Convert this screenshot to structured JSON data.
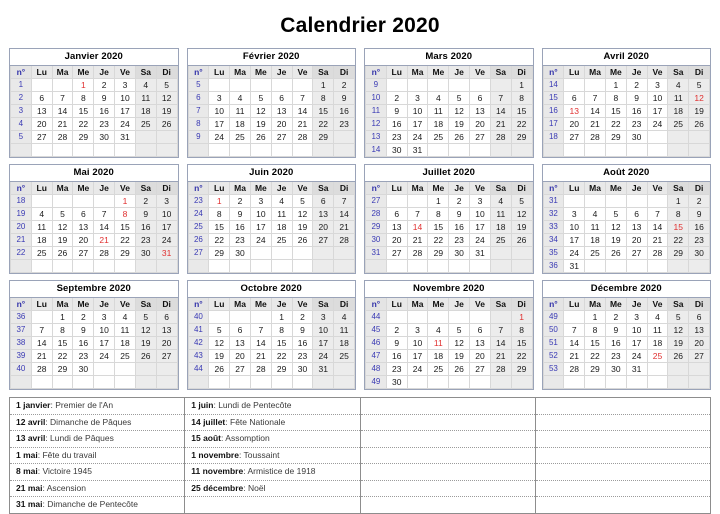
{
  "title": "Calendrier 2020",
  "colors": {
    "holiday": "#e03030",
    "weeknum": "#3a3ab4",
    "weekend_bg": "#ececec",
    "header_bg": "#e9e9e9",
    "month_border": "#9aa3b8"
  },
  "dow_header": {
    "weeknum": "n°",
    "days": [
      "Lu",
      "Ma",
      "Me",
      "Je",
      "Ve",
      "Sa",
      "Di"
    ]
  },
  "months": [
    {
      "name": "Janvier 2020",
      "weeks": [
        {
          "n": "1",
          "days": [
            "",
            "",
            "1",
            "2",
            "3",
            "4",
            "5"
          ],
          "holidays": [
            1
          ]
        },
        {
          "n": "2",
          "days": [
            "6",
            "7",
            "8",
            "9",
            "10",
            "11",
            "12"
          ],
          "holidays": []
        },
        {
          "n": "3",
          "days": [
            "13",
            "14",
            "15",
            "16",
            "17",
            "18",
            "19"
          ],
          "holidays": []
        },
        {
          "n": "4",
          "days": [
            "20",
            "21",
            "22",
            "23",
            "24",
            "25",
            "26"
          ],
          "holidays": []
        },
        {
          "n": "5",
          "days": [
            "27",
            "28",
            "29",
            "30",
            "31",
            "",
            ""
          ],
          "holidays": []
        }
      ]
    },
    {
      "name": "Février 2020",
      "weeks": [
        {
          "n": "5",
          "days": [
            "",
            "",
            "",
            "",
            "",
            "1",
            "2"
          ],
          "holidays": []
        },
        {
          "n": "6",
          "days": [
            "3",
            "4",
            "5",
            "6",
            "7",
            "8",
            "9"
          ],
          "holidays": []
        },
        {
          "n": "7",
          "days": [
            "10",
            "11",
            "12",
            "13",
            "14",
            "15",
            "16"
          ],
          "holidays": []
        },
        {
          "n": "8",
          "days": [
            "17",
            "18",
            "19",
            "20",
            "21",
            "22",
            "23"
          ],
          "holidays": []
        },
        {
          "n": "9",
          "days": [
            "24",
            "25",
            "26",
            "27",
            "28",
            "29",
            ""
          ],
          "holidays": []
        }
      ]
    },
    {
      "name": "Mars 2020",
      "weeks": [
        {
          "n": "9",
          "days": [
            "",
            "",
            "",
            "",
            "",
            "",
            "1"
          ],
          "holidays": []
        },
        {
          "n": "10",
          "days": [
            "2",
            "3",
            "4",
            "5",
            "6",
            "7",
            "8"
          ],
          "holidays": []
        },
        {
          "n": "11",
          "days": [
            "9",
            "10",
            "11",
            "12",
            "13",
            "14",
            "15"
          ],
          "holidays": []
        },
        {
          "n": "12",
          "days": [
            "16",
            "17",
            "18",
            "19",
            "20",
            "21",
            "22"
          ],
          "holidays": []
        },
        {
          "n": "13",
          "days": [
            "23",
            "24",
            "25",
            "26",
            "27",
            "28",
            "29"
          ],
          "holidays": []
        },
        {
          "n": "14",
          "days": [
            "30",
            "31",
            "",
            "",
            "",
            "",
            ""
          ],
          "holidays": []
        }
      ]
    },
    {
      "name": "Avril 2020",
      "weeks": [
        {
          "n": "14",
          "days": [
            "",
            "",
            "1",
            "2",
            "3",
            "4",
            "5"
          ],
          "holidays": []
        },
        {
          "n": "15",
          "days": [
            "6",
            "7",
            "8",
            "9",
            "10",
            "11",
            "12"
          ],
          "holidays": [
            12
          ]
        },
        {
          "n": "16",
          "days": [
            "13",
            "14",
            "15",
            "16",
            "17",
            "18",
            "19"
          ],
          "holidays": [
            13
          ]
        },
        {
          "n": "17",
          "days": [
            "20",
            "21",
            "22",
            "23",
            "24",
            "25",
            "26"
          ],
          "holidays": []
        },
        {
          "n": "18",
          "days": [
            "27",
            "28",
            "29",
            "30",
            "",
            "",
            ""
          ],
          "holidays": []
        }
      ]
    },
    {
      "name": "Mai 2020",
      "weeks": [
        {
          "n": "18",
          "days": [
            "",
            "",
            "",
            "",
            "1",
            "2",
            "3"
          ],
          "holidays": [
            1
          ]
        },
        {
          "n": "19",
          "days": [
            "4",
            "5",
            "6",
            "7",
            "8",
            "9",
            "10"
          ],
          "holidays": [
            8
          ]
        },
        {
          "n": "20",
          "days": [
            "11",
            "12",
            "13",
            "14",
            "15",
            "16",
            "17"
          ],
          "holidays": []
        },
        {
          "n": "21",
          "days": [
            "18",
            "19",
            "20",
            "21",
            "22",
            "23",
            "24"
          ],
          "holidays": [
            21
          ]
        },
        {
          "n": "22",
          "days": [
            "25",
            "26",
            "27",
            "28",
            "29",
            "30",
            "31"
          ],
          "holidays": [
            31
          ]
        }
      ]
    },
    {
      "name": "Juin 2020",
      "weeks": [
        {
          "n": "23",
          "days": [
            "1",
            "2",
            "3",
            "4",
            "5",
            "6",
            "7"
          ],
          "holidays": [
            1
          ]
        },
        {
          "n": "24",
          "days": [
            "8",
            "9",
            "10",
            "11",
            "12",
            "13",
            "14"
          ],
          "holidays": []
        },
        {
          "n": "25",
          "days": [
            "15",
            "16",
            "17",
            "18",
            "19",
            "20",
            "21"
          ],
          "holidays": []
        },
        {
          "n": "26",
          "days": [
            "22",
            "23",
            "24",
            "25",
            "26",
            "27",
            "28"
          ],
          "holidays": []
        },
        {
          "n": "27",
          "days": [
            "29",
            "30",
            "",
            "",
            "",
            "",
            ""
          ],
          "holidays": []
        }
      ]
    },
    {
      "name": "Juillet 2020",
      "weeks": [
        {
          "n": "27",
          "days": [
            "",
            "",
            "1",
            "2",
            "3",
            "4",
            "5"
          ],
          "holidays": []
        },
        {
          "n": "28",
          "days": [
            "6",
            "7",
            "8",
            "9",
            "10",
            "11",
            "12"
          ],
          "holidays": []
        },
        {
          "n": "29",
          "days": [
            "13",
            "14",
            "15",
            "16",
            "17",
            "18",
            "19"
          ],
          "holidays": [
            14
          ]
        },
        {
          "n": "30",
          "days": [
            "20",
            "21",
            "22",
            "23",
            "24",
            "25",
            "26"
          ],
          "holidays": []
        },
        {
          "n": "31",
          "days": [
            "27",
            "28",
            "29",
            "30",
            "31",
            "",
            ""
          ],
          "holidays": []
        }
      ]
    },
    {
      "name": "Août 2020",
      "weeks": [
        {
          "n": "31",
          "days": [
            "",
            "",
            "",
            "",
            "",
            "1",
            "2"
          ],
          "holidays": []
        },
        {
          "n": "32",
          "days": [
            "3",
            "4",
            "5",
            "6",
            "7",
            "8",
            "9"
          ],
          "holidays": []
        },
        {
          "n": "33",
          "days": [
            "10",
            "11",
            "12",
            "13",
            "14",
            "15",
            "16"
          ],
          "holidays": [
            15
          ]
        },
        {
          "n": "34",
          "days": [
            "17",
            "18",
            "19",
            "20",
            "21",
            "22",
            "23"
          ],
          "holidays": []
        },
        {
          "n": "35",
          "days": [
            "24",
            "25",
            "26",
            "27",
            "28",
            "29",
            "30"
          ],
          "holidays": []
        },
        {
          "n": "36",
          "days": [
            "31",
            "",
            "",
            "",
            "",
            "",
            ""
          ],
          "holidays": []
        }
      ]
    },
    {
      "name": "Septembre 2020",
      "weeks": [
        {
          "n": "36",
          "days": [
            "",
            "1",
            "2",
            "3",
            "4",
            "5",
            "6"
          ],
          "holidays": []
        },
        {
          "n": "37",
          "days": [
            "7",
            "8",
            "9",
            "10",
            "11",
            "12",
            "13"
          ],
          "holidays": []
        },
        {
          "n": "38",
          "days": [
            "14",
            "15",
            "16",
            "17",
            "18",
            "19",
            "20"
          ],
          "holidays": []
        },
        {
          "n": "39",
          "days": [
            "21",
            "22",
            "23",
            "24",
            "25",
            "26",
            "27"
          ],
          "holidays": []
        },
        {
          "n": "40",
          "days": [
            "28",
            "29",
            "30",
            "",
            "",
            "",
            ""
          ],
          "holidays": []
        }
      ]
    },
    {
      "name": "Octobre 2020",
      "weeks": [
        {
          "n": "40",
          "days": [
            "",
            "",
            "",
            "1",
            "2",
            "3",
            "4"
          ],
          "holidays": []
        },
        {
          "n": "41",
          "days": [
            "5",
            "6",
            "7",
            "8",
            "9",
            "10",
            "11"
          ],
          "holidays": []
        },
        {
          "n": "42",
          "days": [
            "12",
            "13",
            "14",
            "15",
            "16",
            "17",
            "18"
          ],
          "holidays": []
        },
        {
          "n": "43",
          "days": [
            "19",
            "20",
            "21",
            "22",
            "23",
            "24",
            "25"
          ],
          "holidays": []
        },
        {
          "n": "44",
          "days": [
            "26",
            "27",
            "28",
            "29",
            "30",
            "31",
            ""
          ],
          "holidays": []
        }
      ]
    },
    {
      "name": "Novembre 2020",
      "weeks": [
        {
          "n": "44",
          "days": [
            "",
            "",
            "",
            "",
            "",
            "",
            "1"
          ],
          "holidays": [
            1
          ]
        },
        {
          "n": "45",
          "days": [
            "2",
            "3",
            "4",
            "5",
            "6",
            "7",
            "8"
          ],
          "holidays": []
        },
        {
          "n": "46",
          "days": [
            "9",
            "10",
            "11",
            "12",
            "13",
            "14",
            "15"
          ],
          "holidays": [
            11
          ]
        },
        {
          "n": "47",
          "days": [
            "16",
            "17",
            "18",
            "19",
            "20",
            "21",
            "22"
          ],
          "holidays": []
        },
        {
          "n": "48",
          "days": [
            "23",
            "24",
            "25",
            "26",
            "27",
            "28",
            "29"
          ],
          "holidays": []
        },
        {
          "n": "49",
          "days": [
            "30",
            "",
            "",
            "",
            "",
            "",
            ""
          ],
          "holidays": []
        }
      ]
    },
    {
      "name": "Décembre 2020",
      "weeks": [
        {
          "n": "49",
          "days": [
            "",
            "1",
            "2",
            "3",
            "4",
            "5",
            "6"
          ],
          "holidays": []
        },
        {
          "n": "50",
          "days": [
            "7",
            "8",
            "9",
            "10",
            "11",
            "12",
            "13"
          ],
          "holidays": []
        },
        {
          "n": "51",
          "days": [
            "14",
            "15",
            "16",
            "17",
            "18",
            "19",
            "20"
          ],
          "holidays": []
        },
        {
          "n": "52",
          "days": [
            "21",
            "22",
            "23",
            "24",
            "25",
            "26",
            "27"
          ],
          "holidays": [
            25
          ]
        },
        {
          "n": "53",
          "days": [
            "28",
            "29",
            "30",
            "31",
            "",
            "",
            ""
          ],
          "holidays": []
        }
      ]
    }
  ],
  "legend": {
    "columns": [
      [
        {
          "date": "1 janvier",
          "name": "Premier de l'An"
        },
        {
          "date": "12 avril",
          "name": "Dimanche de Pâques"
        },
        {
          "date": "13 avril",
          "name": "Lundi de Pâques"
        },
        {
          "date": "1 mai",
          "name": "Fête du travail"
        },
        {
          "date": "8 mai",
          "name": "Victoire 1945"
        },
        {
          "date": "21 mai",
          "name": "Ascension"
        },
        {
          "date": "31 mai",
          "name": "Dimanche de Pentecôte"
        }
      ],
      [
        {
          "date": "1 juin",
          "name": "Lundi de Pentecôte"
        },
        {
          "date": "14 juillet",
          "name": "Fête Nationale"
        },
        {
          "date": "15 août",
          "name": "Assomption"
        },
        {
          "date": "1 novembre",
          "name": "Toussaint"
        },
        {
          "date": "11 novembre",
          "name": "Armistice de 1918"
        },
        {
          "date": "25 décembre",
          "name": "Noël"
        },
        {
          "date": "",
          "name": ""
        }
      ],
      [
        {
          "date": "",
          "name": ""
        },
        {
          "date": "",
          "name": ""
        },
        {
          "date": "",
          "name": ""
        },
        {
          "date": "",
          "name": ""
        },
        {
          "date": "",
          "name": ""
        },
        {
          "date": "",
          "name": ""
        },
        {
          "date": "",
          "name": ""
        }
      ],
      [
        {
          "date": "",
          "name": ""
        },
        {
          "date": "",
          "name": ""
        },
        {
          "date": "",
          "name": ""
        },
        {
          "date": "",
          "name": ""
        },
        {
          "date": "",
          "name": ""
        },
        {
          "date": "",
          "name": ""
        },
        {
          "date": "",
          "name": ""
        }
      ]
    ]
  }
}
